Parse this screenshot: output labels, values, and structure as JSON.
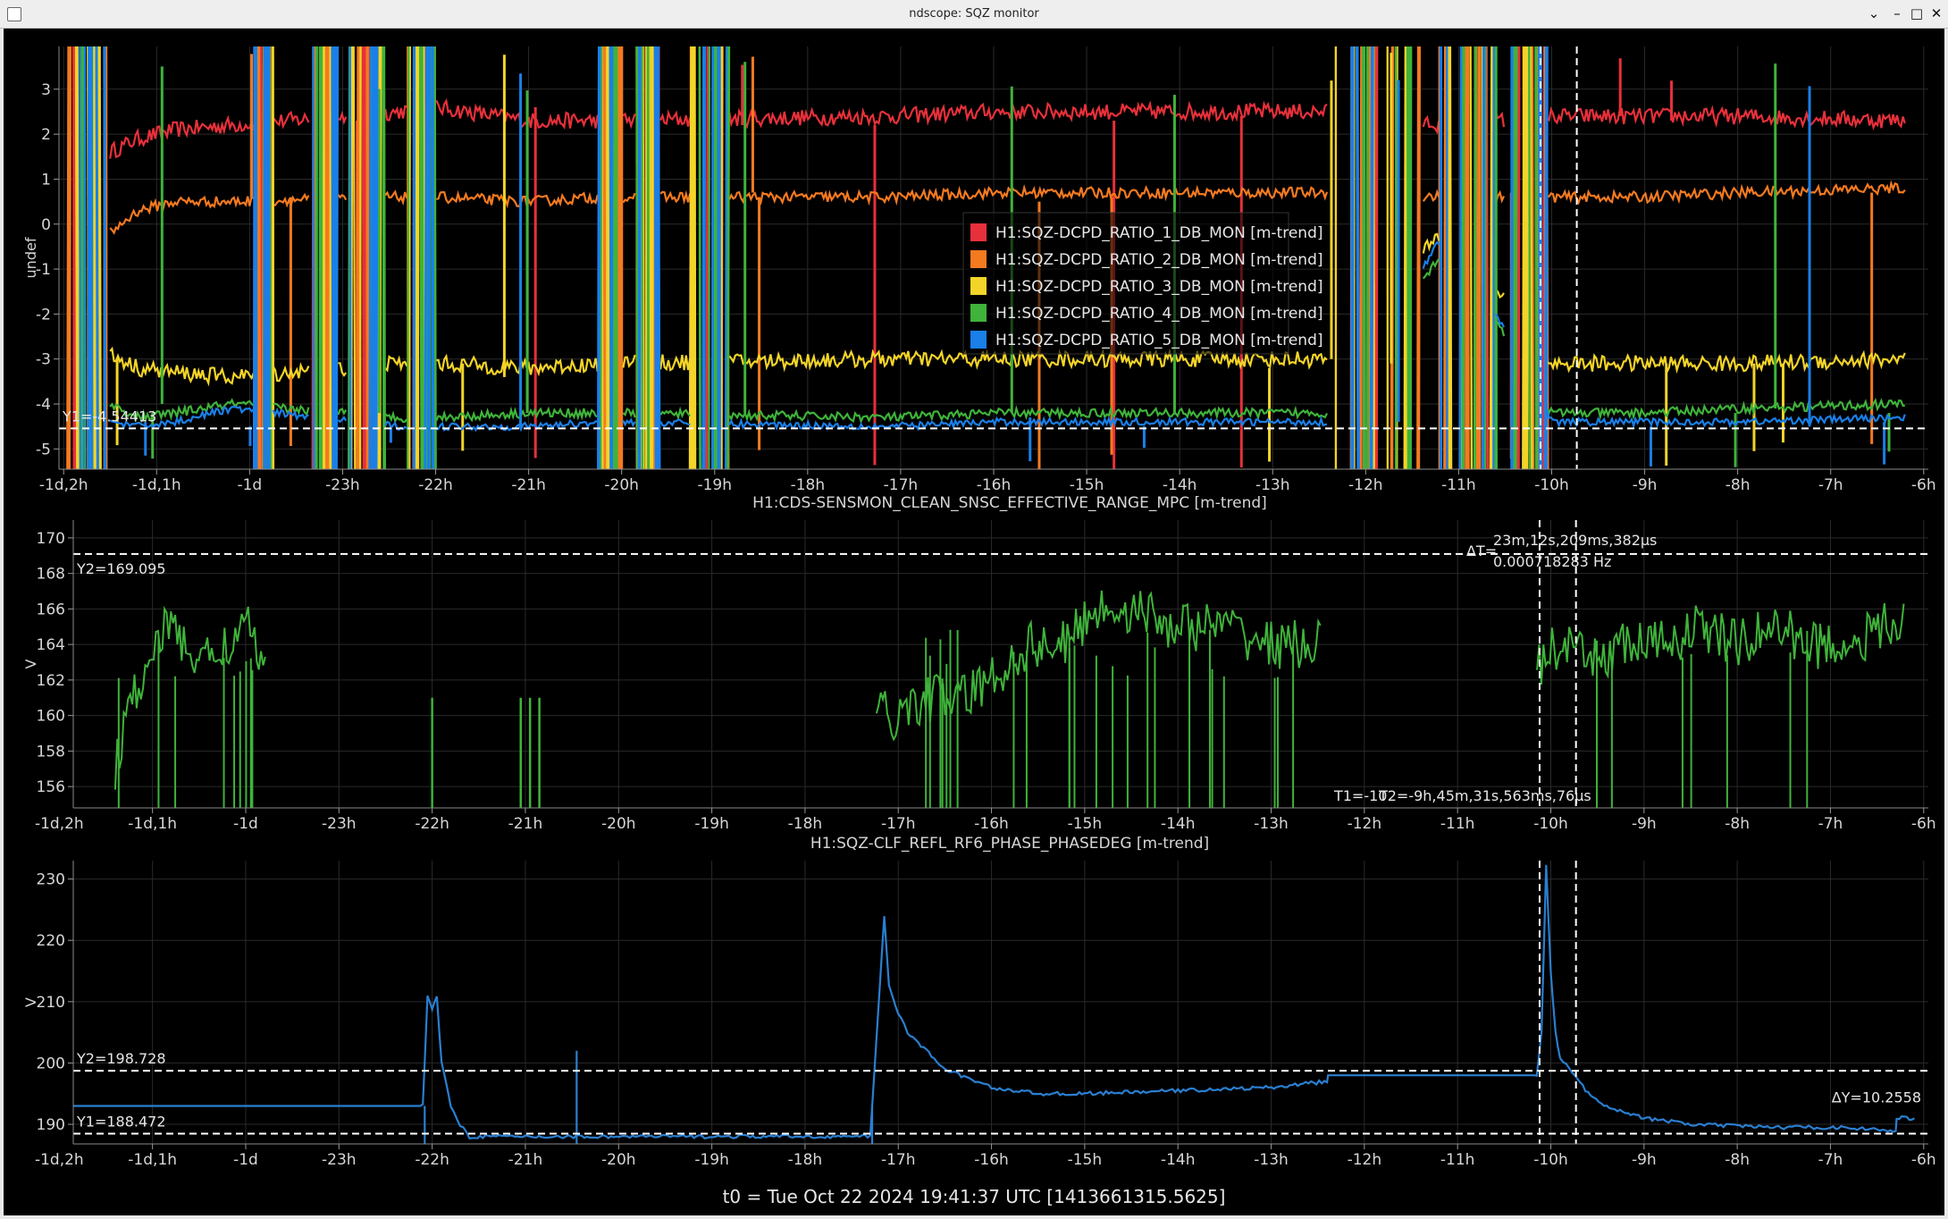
{
  "window": {
    "title": "ndscope: SQZ monitor",
    "buttons": [
      "⌄",
      "–",
      "□",
      "✕"
    ]
  },
  "footer": "t0 = Tue Oct 22 2024 19:41:37 UTC [1413661315.5625]",
  "xaxis": {
    "labels": [
      "-1d,2h",
      "-1d,1h",
      "-1d",
      "-23h",
      "-22h",
      "-21h",
      "-20h",
      "-19h",
      "-18h",
      "-17h",
      "-16h",
      "-15h",
      "-14h",
      "-13h",
      "-12h",
      "-11h",
      "-10h",
      "-9h",
      "-8h",
      "-7h",
      "-6h"
    ],
    "values": [
      -26,
      -25,
      -24,
      -23,
      -22,
      -21,
      -20,
      -19,
      -18,
      -17,
      -16,
      -15,
      -14,
      -13,
      -12,
      -11,
      -10,
      -9,
      -8,
      -7,
      -6
    ],
    "range_plot1": [
      -26.05,
      -5.95
    ],
    "range_plot23": [
      -25.85,
      -5.95
    ]
  },
  "cursors": {
    "t1": -10.12,
    "t2": -9.73,
    "t1_label": "T1=-10",
    "t2_label": "T2=-9h,45m,31s,563ms,76µs",
    "dt_label": "ΔT=",
    "dt_value": "23m,12s,209ms,382µs",
    "dt_freq": "0.000718283 Hz"
  },
  "plots": [
    {
      "ylabel": "undef",
      "title": "",
      "y_range": [
        -5.45,
        3.95
      ],
      "y_ticks": [
        "3",
        "2",
        "1",
        "0",
        "-1",
        "-2",
        "-3",
        "-4",
        "-5"
      ],
      "y_tick_values": [
        3,
        2,
        1,
        0,
        -1,
        -2,
        -3,
        -4,
        -5
      ],
      "cursor_y": [
        {
          "value": -4.54413,
          "label": "Y1=-4.54413"
        }
      ],
      "legend": [
        {
          "name": "H1:SQZ-DCPD_RATIO_1_DB_MON [m-trend]",
          "color": "#e8303a"
        },
        {
          "name": "H1:SQZ-DCPD_RATIO_2_DB_MON [m-trend]",
          "color": "#f47a20"
        },
        {
          "name": "H1:SQZ-DCPD_RATIO_3_DB_MON [m-trend]",
          "color": "#f3d428"
        },
        {
          "name": "H1:SQZ-DCPD_RATIO_4_DB_MON [m-trend]",
          "color": "#3fb33a"
        },
        {
          "name": "H1:SQZ-DCPD_RATIO_5_DB_MON [m-trend]",
          "color": "#1a7fe8"
        }
      ]
    },
    {
      "ylabel": "V",
      "title": "H1:CDS-SENSMON_CLEAN_SNSC_EFFECTIVE_RANGE_MPC [m-trend]",
      "y_range": [
        154.8,
        171.0
      ],
      "y_ticks": [
        "170",
        "168",
        "166",
        "164",
        "162",
        "160",
        "158",
        "156"
      ],
      "y_tick_values": [
        170,
        168,
        166,
        164,
        162,
        160,
        158,
        156
      ],
      "cursor_y": [
        {
          "value": 169.095,
          "label": "Y2=169.095"
        }
      ],
      "color": "#3fb33a"
    },
    {
      "ylabel": "V",
      "title": "H1:SQZ-CLF_REFL_RF6_PHASE_PHASEDEG [m-trend]",
      "y_range": [
        186.8,
        233.0
      ],
      "y_ticks": [
        "230",
        "220",
        "210",
        "200",
        "190"
      ],
      "y_tick_values": [
        230,
        220,
        210,
        200,
        190
      ],
      "cursor_y": [
        {
          "value": 198.728,
          "label": "Y2=198.728"
        },
        {
          "value": 188.472,
          "label": "Y1=188.472"
        }
      ],
      "dy_label": "ΔY=10.2558",
      "color": "#2a7fd0"
    }
  ],
  "chart_data": [
    {
      "type": "line",
      "ylabel": "undef",
      "xlabel": "",
      "ylim": [
        -5.45,
        3.95
      ],
      "series": [
        {
          "name": "H1:SQZ-DCPD_RATIO_1_DB_MON [m-trend]",
          "x": [
            -25.5,
            -25.2,
            -24.8,
            -24.2,
            -22.4,
            -22.0,
            -21.0,
            -20.2,
            -17.1,
            -16.0,
            -14.0,
            -12.4,
            -11.1,
            -10.0,
            -9.0,
            -8.0,
            -6.2
          ],
          "values": [
            1.6,
            1.9,
            2.1,
            2.2,
            2.5,
            2.6,
            2.3,
            2.3,
            2.4,
            2.5,
            2.5,
            2.5,
            2.2,
            2.4,
            2.4,
            2.4,
            2.3
          ]
        },
        {
          "name": "H1:SQZ-DCPD_RATIO_2_DB_MON [m-trend]",
          "x": [
            -25.5,
            -25.2,
            -24.8,
            -24.2,
            -22.4,
            -22.0,
            -21.0,
            -20.2,
            -17.1,
            -16.0,
            -14.0,
            -12.4,
            -11.1,
            -10.0,
            -9.0,
            -8.0,
            -6.2
          ],
          "values": [
            -0.2,
            0.3,
            0.5,
            0.5,
            0.6,
            0.6,
            0.5,
            0.6,
            0.6,
            0.7,
            0.7,
            0.7,
            0.6,
            0.6,
            0.6,
            0.7,
            0.8
          ]
        },
        {
          "name": "H1:SQZ-DCPD_RATIO_3_DB_MON [m-trend]",
          "x": [
            -25.5,
            -25.2,
            -24.8,
            -24.2,
            -22.4,
            -22.0,
            -21.0,
            -20.2,
            -17.1,
            -16.0,
            -14.0,
            -12.4,
            -11.1,
            -10.0,
            -9.0,
            -8.0,
            -6.2
          ],
          "values": [
            -2.9,
            -3.2,
            -3.3,
            -3.4,
            -3.1,
            -3.1,
            -3.2,
            -3.1,
            -3.0,
            -3.0,
            -3.0,
            -3.0,
            0.0,
            -3.1,
            -3.1,
            -3.1,
            -3.0
          ]
        },
        {
          "name": "H1:SQZ-DCPD_RATIO_4_DB_MON [m-trend]",
          "x": [
            -25.5,
            -25.2,
            -24.8,
            -24.2,
            -22.4,
            -22.0,
            -21.0,
            -20.2,
            -17.1,
            -16.0,
            -14.0,
            -12.4,
            -11.1,
            -10.0,
            -9.0,
            -8.0,
            -6.2
          ],
          "values": [
            -4.0,
            -4.3,
            -4.2,
            -4.0,
            -4.3,
            -4.3,
            -4.2,
            -4.2,
            -4.3,
            -4.2,
            -4.2,
            -4.2,
            -0.4,
            -4.2,
            -4.2,
            -4.1,
            -4.0
          ]
        },
        {
          "name": "H1:SQZ-DCPD_RATIO_5_DB_MON [m-trend]",
          "x": [
            -25.5,
            -25.2,
            -24.8,
            -24.2,
            -22.4,
            -22.0,
            -21.0,
            -20.2,
            -17.1,
            -16.0,
            -14.0,
            -12.4,
            -11.1,
            -10.0,
            -9.0,
            -8.0,
            -6.2
          ],
          "values": [
            -4.4,
            -4.5,
            -4.4,
            -4.1,
            -4.5,
            -4.5,
            -4.5,
            -4.4,
            -4.5,
            -4.4,
            -4.4,
            -4.4,
            0.0,
            -4.4,
            -4.4,
            -4.4,
            -4.3
          ]
        }
      ]
    },
    {
      "type": "line",
      "title": "H1:CDS-SENSMON_CLEAN_SNSC_EFFECTIVE_RANGE_MPC [m-trend]",
      "ylabel": "V",
      "ylim": [
        154.8,
        171.0
      ],
      "series": [
        {
          "x": [
            -25.4,
            -25.2,
            -25.0,
            -24.8,
            -24.5,
            -24.2,
            -24.0,
            -23.8,
            -17.2,
            -17.0,
            -16.7,
            -16.3,
            -16.0,
            -15.6,
            -15.2,
            -14.9,
            -14.5,
            -14.0,
            -13.5,
            -13.0,
            -12.5,
            -10.1,
            -9.9,
            -9.6,
            -9.2,
            -8.8,
            -8.4,
            -8.0,
            -7.6,
            -7.2,
            -6.8,
            -6.4,
            -6.2
          ],
          "values": [
            157,
            161,
            164,
            165,
            163,
            164,
            165,
            163,
            160,
            160,
            161,
            161,
            162,
            164,
            164,
            166,
            166,
            165,
            165,
            164,
            164,
            163,
            164,
            163,
            164,
            164,
            165,
            164,
            165,
            164,
            164,
            165,
            165
          ]
        }
      ]
    },
    {
      "type": "line",
      "title": "H1:SQZ-CLF_REFL_RF6_PHASE_PHASEDEG [m-trend]",
      "ylabel": "V",
      "ylim": [
        186.8,
        233.0
      ],
      "series": [
        {
          "x": [
            -25.85,
            -22.1,
            -22.05,
            -22.0,
            -21.95,
            -21.9,
            -21.8,
            -21.7,
            -21.6,
            -17.3,
            -17.2,
            -17.15,
            -17.1,
            -17.0,
            -16.9,
            -16.5,
            -16.0,
            -15.5,
            -15.0,
            -14.0,
            -13.0,
            -12.4,
            -12.39,
            -10.15,
            -10.1,
            -10.05,
            -10.0,
            -9.95,
            -9.9,
            -9.8,
            -9.6,
            -9.4,
            -9.0,
            -8.5,
            -8.0,
            -7.5,
            -7.0,
            -6.6,
            -6.5,
            -6.3,
            -6.29,
            -6.1
          ],
          "values": [
            193,
            193,
            211,
            209,
            211,
            200,
            193,
            190,
            188,
            188,
            212,
            224,
            213,
            208,
            205,
            199,
            196,
            195,
            195,
            195.5,
            196,
            197,
            198,
            198,
            205,
            232,
            215,
            205,
            201,
            199,
            195,
            193,
            191,
            190,
            189.7,
            189.5,
            189.5,
            189.3,
            189,
            189,
            191,
            191
          ]
        }
      ]
    }
  ]
}
